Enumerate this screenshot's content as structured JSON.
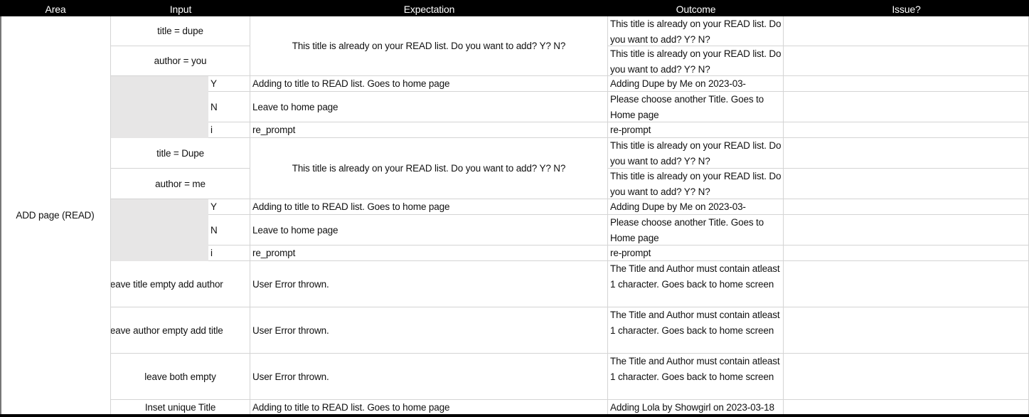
{
  "headers": {
    "area": "Area",
    "input": "Input",
    "expectation": "Expectation",
    "outcome": "Outcome",
    "issue": "Issue?"
  },
  "area": "ADD page (READ)",
  "dupe_prompt": "This title is already on your READ list. Do you want to add? Y? N?",
  "rows": [
    {
      "input": "title = dupe",
      "outcome": "This title is already on your READ list. Do you want to add? Y? N?",
      "issue": ""
    },
    {
      "input": "author = you",
      "outcome": "This title is already on your READ list. Do you want to add? Y? N?",
      "issue": ""
    },
    {
      "key": "Y",
      "expectation": "Adding to title to READ list. Goes to home page",
      "outcome": "Adding Dupe by Me on 2023-03-",
      "issue": ""
    },
    {
      "key": "N",
      "expectation": "Leave to home page",
      "outcome": "Please choose another Title. Goes to Home page",
      "issue": ""
    },
    {
      "key": "i",
      "expectation": "re_prompt",
      "outcome": "re-prompt",
      "issue": ""
    },
    {
      "input": "title = Dupe",
      "outcome": "This title is already on your READ list. Do you want to add? Y? N?",
      "issue": ""
    },
    {
      "input": "author = me",
      "outcome": "This title is already on your READ list. Do you want to add? Y? N?",
      "issue": ""
    },
    {
      "key": "Y",
      "expectation": "Adding to title to READ list. Goes to home page",
      "outcome": "Adding Dupe by Me on 2023-03-",
      "issue": ""
    },
    {
      "key": "N",
      "expectation": "Leave to home page",
      "outcome": "Please choose another Title. Goes to Home page",
      "issue": ""
    },
    {
      "key": "i",
      "expectation": "re_prompt",
      "outcome": "re-prompt",
      "issue": ""
    },
    {
      "input": "leave title empty add author",
      "expectation": "User Error thrown.",
      "outcome": "The Title and Author must contain atleast 1 character. Goes back to home screen",
      "issue": ""
    },
    {
      "input": "leave author empty add title",
      "expectation": "User Error thrown.",
      "outcome": "The Title and Author must contain atleast 1 character. Goes back to home screen",
      "issue": ""
    },
    {
      "input": "leave both empty",
      "expectation": "User Error thrown.",
      "outcome": "The Title and Author must contain atleast 1 character. Goes back to home screen",
      "issue": ""
    },
    {
      "input": "Inset unique Title",
      "expectation": "Adding to title to READ list. Goes to home page",
      "outcome": "Adding Lola by Showgirl on 2023-03-18",
      "issue": ""
    }
  ]
}
